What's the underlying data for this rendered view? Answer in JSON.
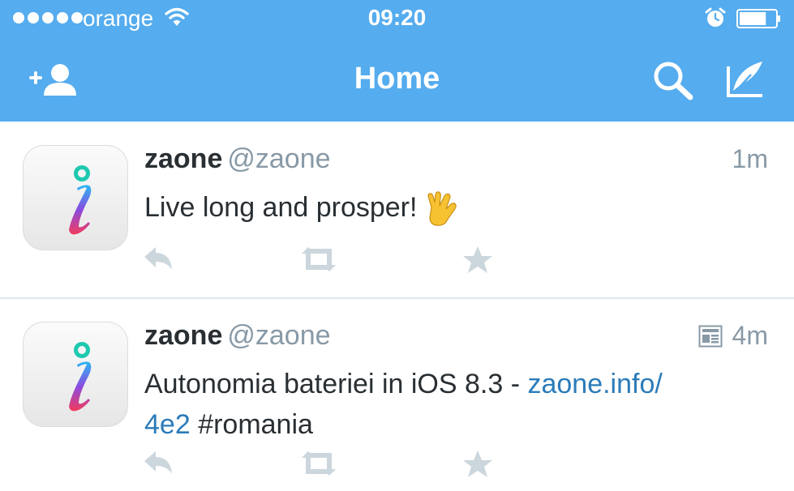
{
  "status_bar": {
    "carrier": "orange",
    "time": "09:20",
    "signal_bars": 5,
    "battery_level": 0.75,
    "icons": [
      "signal-dots-icon",
      "wifi-icon",
      "alarm-clock-icon",
      "battery-icon"
    ]
  },
  "nav": {
    "title": "Home",
    "icons": [
      "add-user-icon",
      "search-icon",
      "compose-tweet-icon"
    ]
  },
  "colors": {
    "header_bg": "#55acee",
    "link": "#2b7bb9",
    "muted": "#8899a6",
    "text": "#292f33"
  },
  "tweets": [
    {
      "name": "zaone",
      "handle": "@zaone",
      "time": "1m",
      "text": "Live long and prosper!",
      "emoji": "vulcan-salute-icon",
      "actions": [
        "reply-icon",
        "retweet-icon",
        "favorite-star-icon"
      ]
    },
    {
      "name": "zaone",
      "handle": "@zaone",
      "time": "4m",
      "has_summary_card": true,
      "text_plain": "Autonomia bateriei in iOS 8.3 - ",
      "link": "zaone.info/4e2",
      "hashtag": "#romania",
      "actions": [
        "reply-icon",
        "retweet-icon",
        "favorite-star-icon"
      ]
    }
  ]
}
